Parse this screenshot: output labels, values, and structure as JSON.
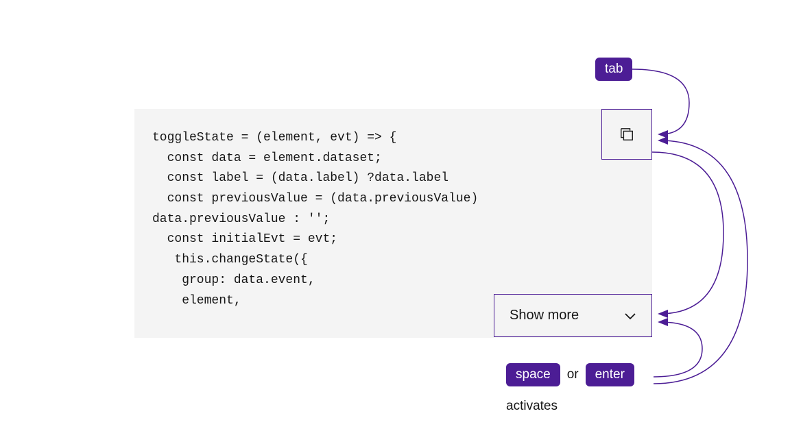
{
  "code": "toggleState = (element, evt) => {\n  const data = element.dataset;\n  const label = (data.label) ?data.label\n  const previousValue = (data.previousValue)\ndata.previousValue : '';\n  const initialEvt = evt;\n   this.changeState({\n    group: data.event,\n    element,",
  "buttons": {
    "showMoreLabel": "Show more"
  },
  "keys": {
    "tab": "tab",
    "space": "space",
    "enter": "enter",
    "or": "or"
  },
  "labels": {
    "activates": "activates"
  },
  "colors": {
    "accent": "#4c1d95",
    "codeBg": "#f4f4f4",
    "text": "#161616"
  }
}
